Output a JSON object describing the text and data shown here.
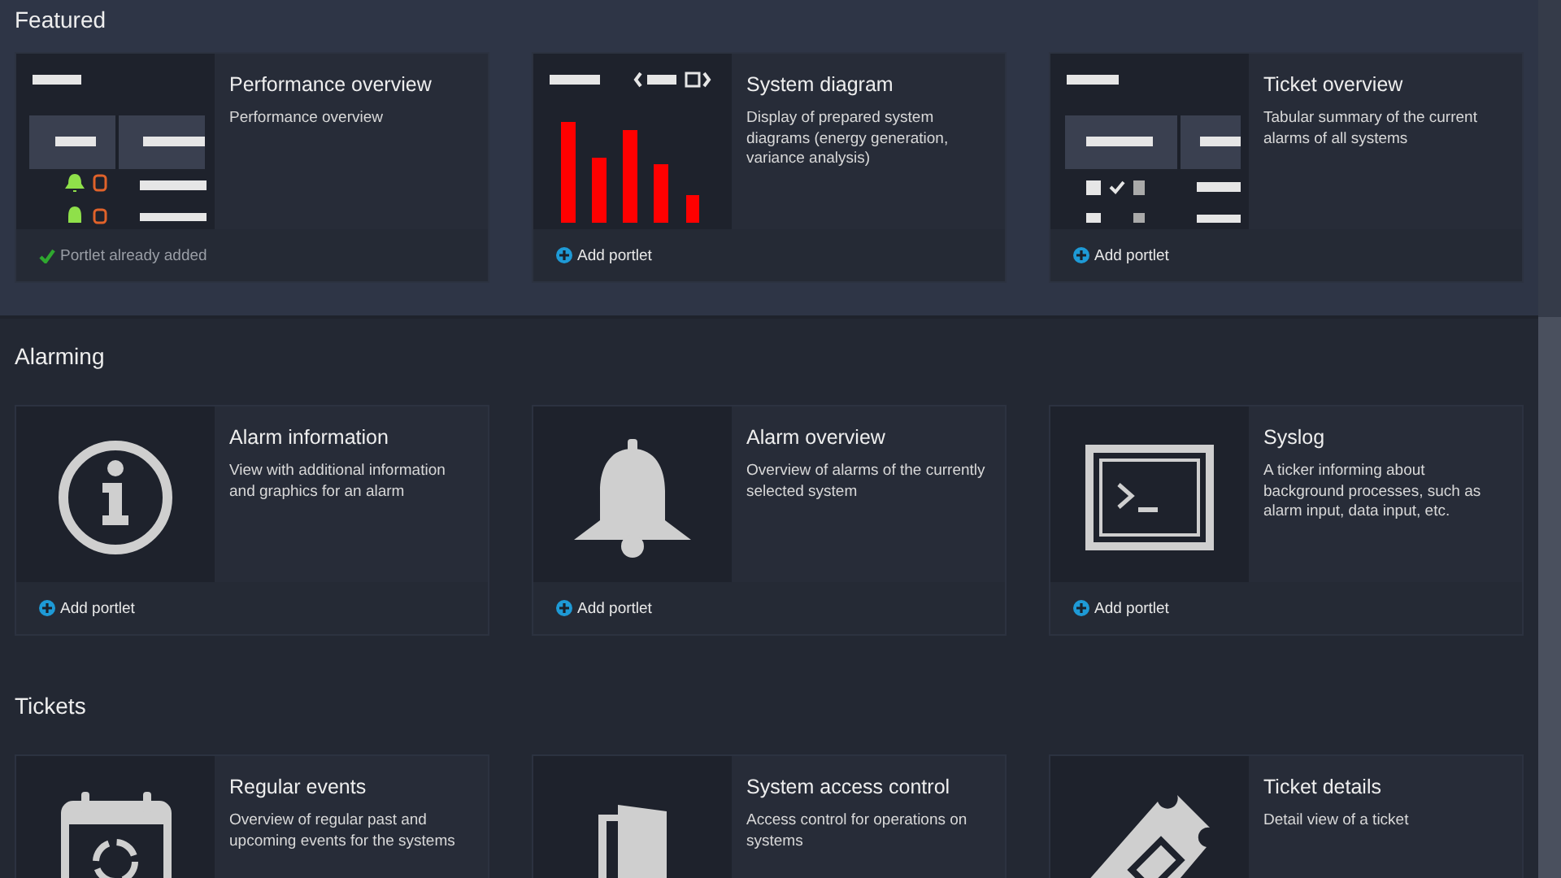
{
  "sections": [
    {
      "title": "Featured",
      "highlighted": true,
      "cards": [
        {
          "title": "Performance overview",
          "description": "Performance overview",
          "kind": "performance-preview",
          "added": true,
          "footer": "Portlet already added"
        },
        {
          "title": "System diagram",
          "description": "Display of prepared system diagrams (energy generation, variance analysis)",
          "kind": "chart-preview",
          "added": false,
          "footer": "Add portlet"
        },
        {
          "title": "Ticket overview",
          "description": "Tabular summary of the current alarms of all systems",
          "kind": "ticket-preview",
          "added": false,
          "footer": "Add portlet"
        }
      ]
    },
    {
      "title": "Alarming",
      "highlighted": false,
      "cards": [
        {
          "title": "Alarm information",
          "description": "View with additional information and graphics for an alarm",
          "kind": "info",
          "added": false,
          "footer": "Add portlet"
        },
        {
          "title": "Alarm overview",
          "description": "Overview of alarms of the currently selected system",
          "kind": "bell",
          "added": false,
          "footer": "Add portlet"
        },
        {
          "title": "Syslog",
          "description": "A ticker informing about background processes, such as alarm input, data input, etc.",
          "kind": "terminal",
          "added": false,
          "footer": "Add portlet"
        }
      ]
    },
    {
      "title": "Tickets",
      "highlighted": false,
      "cards": [
        {
          "title": "Regular events",
          "description": "Overview of regular past and upcoming events for the systems",
          "kind": "calendar"
        },
        {
          "title": "System access control",
          "description": "Access control for operations on systems",
          "kind": "door"
        },
        {
          "title": "Ticket details",
          "description": "Detail view of a ticket",
          "kind": "ticket"
        }
      ]
    }
  ]
}
